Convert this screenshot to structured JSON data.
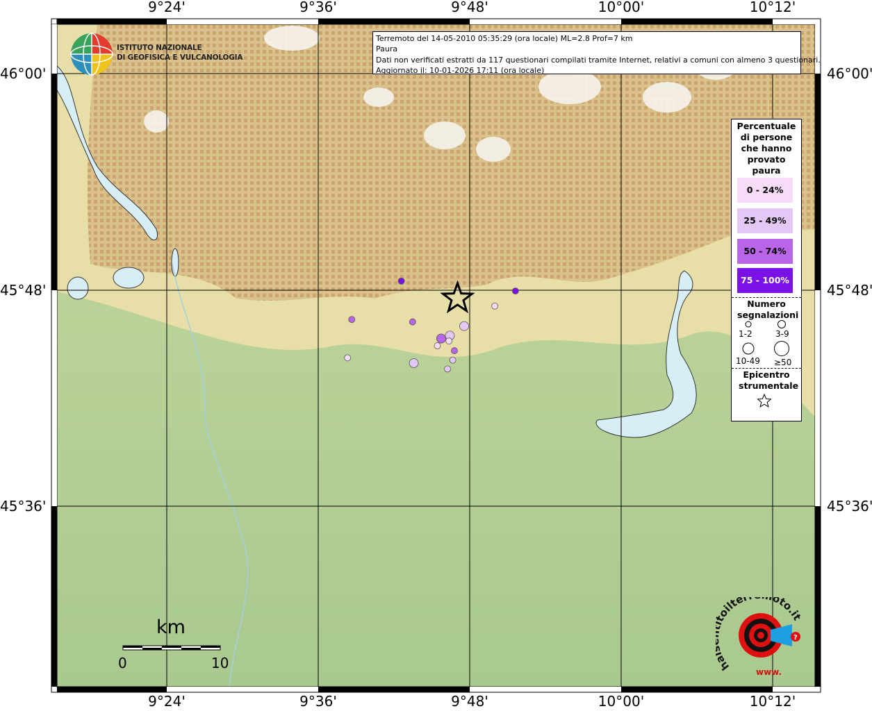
{
  "info": {
    "line1": "Terremoto del 14-05-2010 05:35:29 (ora locale) ML=2.8 Prof=7 km",
    "line2": "Paura",
    "line3": "Dati non verificati estratti da 117 questionari compilati tramite Internet, relativi a comuni con almeno 3 questionari.",
    "line4": "Aggiornato il: 10-01-2026 17:11 (ora locale)"
  },
  "ingv": {
    "line1": "ISTITUTO NAZIONALE",
    "line2": "DI GEOFISICA E VULCANOLOGIA"
  },
  "axes": {
    "longitudes": [
      "9°24'",
      "9°36'",
      "9°48'",
      "10°00'",
      "10°12'"
    ],
    "latitudes": [
      "46°00'",
      "45°48'",
      "45°36'"
    ]
  },
  "legend": {
    "title": "Percentuale di persone che hanno provato paura",
    "classes": [
      {
        "label": "0 - 24%",
        "color": "#f6dcf7"
      },
      {
        "label": "25 - 49%",
        "color": "#e3c8f5"
      },
      {
        "label": "50 - 74%",
        "color": "#b865e8"
      },
      {
        "label": "75 - 100%",
        "color": "#7a11e6"
      }
    ],
    "size_title": "Numero segnalazioni",
    "sizes": [
      "1-2",
      "3-9",
      "10-49",
      "≥50"
    ],
    "epicenter_title": "Epicentro strumentale"
  },
  "scale": {
    "unit": "km",
    "start": "0",
    "end": "10"
  },
  "hsit": {
    "text": "haisentitoilterremoto.it",
    "www": "www."
  },
  "points": [
    {
      "lon": 9.7097,
      "lat": 45.8085,
      "class": 3,
      "size": 0
    },
    {
      "lon": 9.8604,
      "lat": 45.7993,
      "class": 3,
      "size": 0
    },
    {
      "lon": 9.6443,
      "lat": 45.773,
      "class": 2,
      "size": 0
    },
    {
      "lon": 9.7246,
      "lat": 45.7708,
      "class": 2,
      "size": 0
    },
    {
      "lon": 9.8331,
      "lat": 45.7854,
      "class": 0,
      "size": 0
    },
    {
      "lon": 9.7927,
      "lat": 45.7669,
      "class": 1,
      "size": 1
    },
    {
      "lon": 9.7738,
      "lat": 45.7581,
      "class": 1,
      "size": 1
    },
    {
      "lon": 9.7623,
      "lat": 45.7554,
      "class": 2,
      "size": 1
    },
    {
      "lon": 9.7726,
      "lat": 45.7531,
      "class": 0,
      "size": 0
    },
    {
      "lon": 9.7573,
      "lat": 45.7487,
      "class": 0,
      "size": 0
    },
    {
      "lon": 9.7798,
      "lat": 45.7442,
      "class": 2,
      "size": 0
    },
    {
      "lon": 9.6387,
      "lat": 45.7376,
      "class": 0,
      "size": 0
    },
    {
      "lon": 9.7776,
      "lat": 45.7355,
      "class": 1,
      "size": 0
    },
    {
      "lon": 9.7262,
      "lat": 45.7327,
      "class": 1,
      "size": 1
    },
    {
      "lon": 9.7707,
      "lat": 45.7273,
      "class": 1,
      "size": 0
    }
  ],
  "epicenter": {
    "lon": 9.7839,
    "lat": 45.7924
  }
}
